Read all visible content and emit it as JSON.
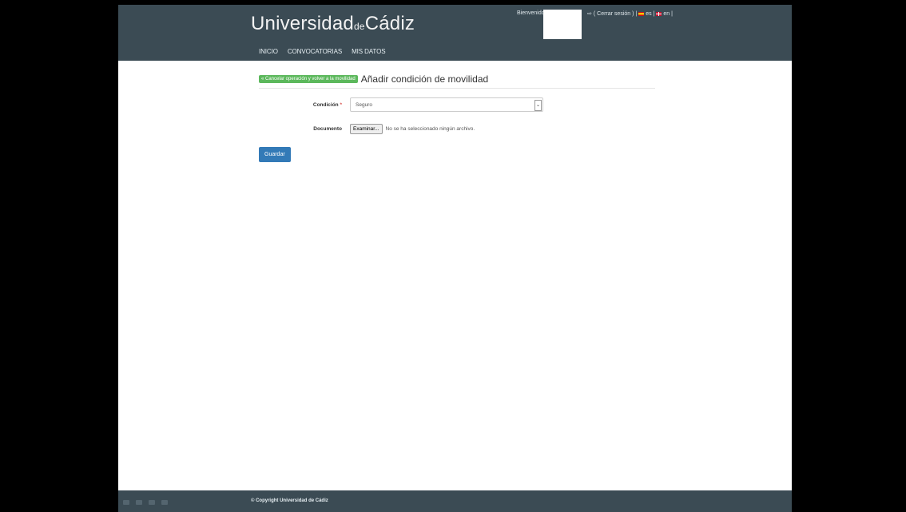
{
  "header": {
    "logo_main": "Universidad",
    "logo_de": "de",
    "logo_end": "Cádiz",
    "nav": [
      "INICIO",
      "CONVOCATORIAS",
      "MIS DATOS"
    ],
    "welcome": "Bienvenido",
    "session": "( Cerrar sesión ) |",
    "lang_es": "es |",
    "lang_en": "en |"
  },
  "main": {
    "cancel_label": "« Cancelar operación y volver a la movilidad",
    "title": "Añadir condición de movilidad",
    "condicion_label": "Condición",
    "required_mark": "*",
    "condicion_value": "Seguro",
    "documento_label": "Documento",
    "file_button": "Examinar...",
    "file_status": "No se ha seleccionado ningún archivo.",
    "save_label": "Guardar"
  },
  "footer": {
    "copyright": "© Copyright Universidad de Cádiz"
  },
  "colors": {
    "header_bg": "#3b4b54",
    "cancel_bg": "#5cb85c",
    "save_bg": "#337ab7"
  }
}
